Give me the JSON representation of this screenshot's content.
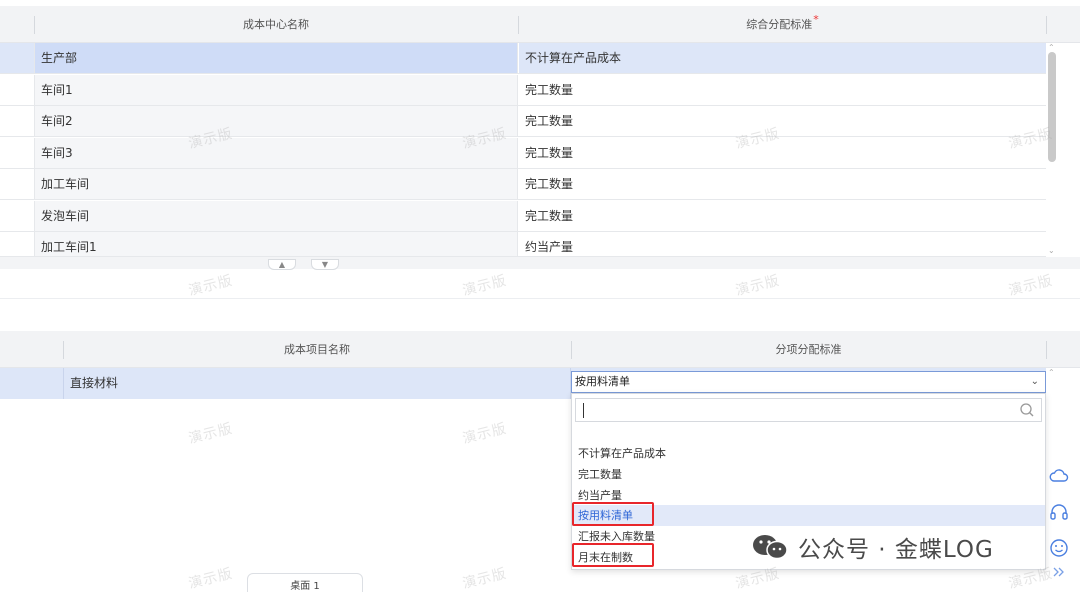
{
  "top_grid": {
    "columns": [
      "成本中心名称",
      "综合分配标准"
    ],
    "required_mark": "*",
    "rows": [
      {
        "name": "生产部",
        "standard": "不计算在产品成本"
      },
      {
        "name": "车间1",
        "standard": "完工数量"
      },
      {
        "name": "车间2",
        "standard": "完工数量"
      },
      {
        "name": "车间3",
        "standard": "完工数量"
      },
      {
        "name": "加工车间",
        "standard": "完工数量"
      },
      {
        "name": "发泡车间",
        "standard": "完工数量"
      },
      {
        "name": "加工车间1",
        "standard": "约当产量"
      }
    ]
  },
  "bottom_grid": {
    "columns": [
      "成本项目名称",
      "分项分配标准"
    ],
    "rows": [
      {
        "name": "直接材料",
        "standard": "按用料清单"
      }
    ]
  },
  "dropdown": {
    "selected": "按用料清单",
    "search_value": "",
    "options": [
      "不计算在产品成本",
      "完工数量",
      "约当产量",
      "按用料清单",
      "汇报未入库数量",
      "月末在制数"
    ],
    "active_option": "按用料清单",
    "highlighted_options": [
      "按用料清单",
      "月末在制数"
    ]
  },
  "watermark_text": "演示版",
  "overlay_brand": {
    "text": "公众号 · 金蝶LOG"
  },
  "bottom_tab": {
    "label": "桌面 1"
  },
  "side_icons": [
    "cloud-icon",
    "headset-icon",
    "smile-icon",
    "double-chevron-right-icon"
  ],
  "colors": {
    "selected_row": "#dde6f8",
    "accent": "#2f66d6",
    "highlight_border": "#e8262b"
  }
}
